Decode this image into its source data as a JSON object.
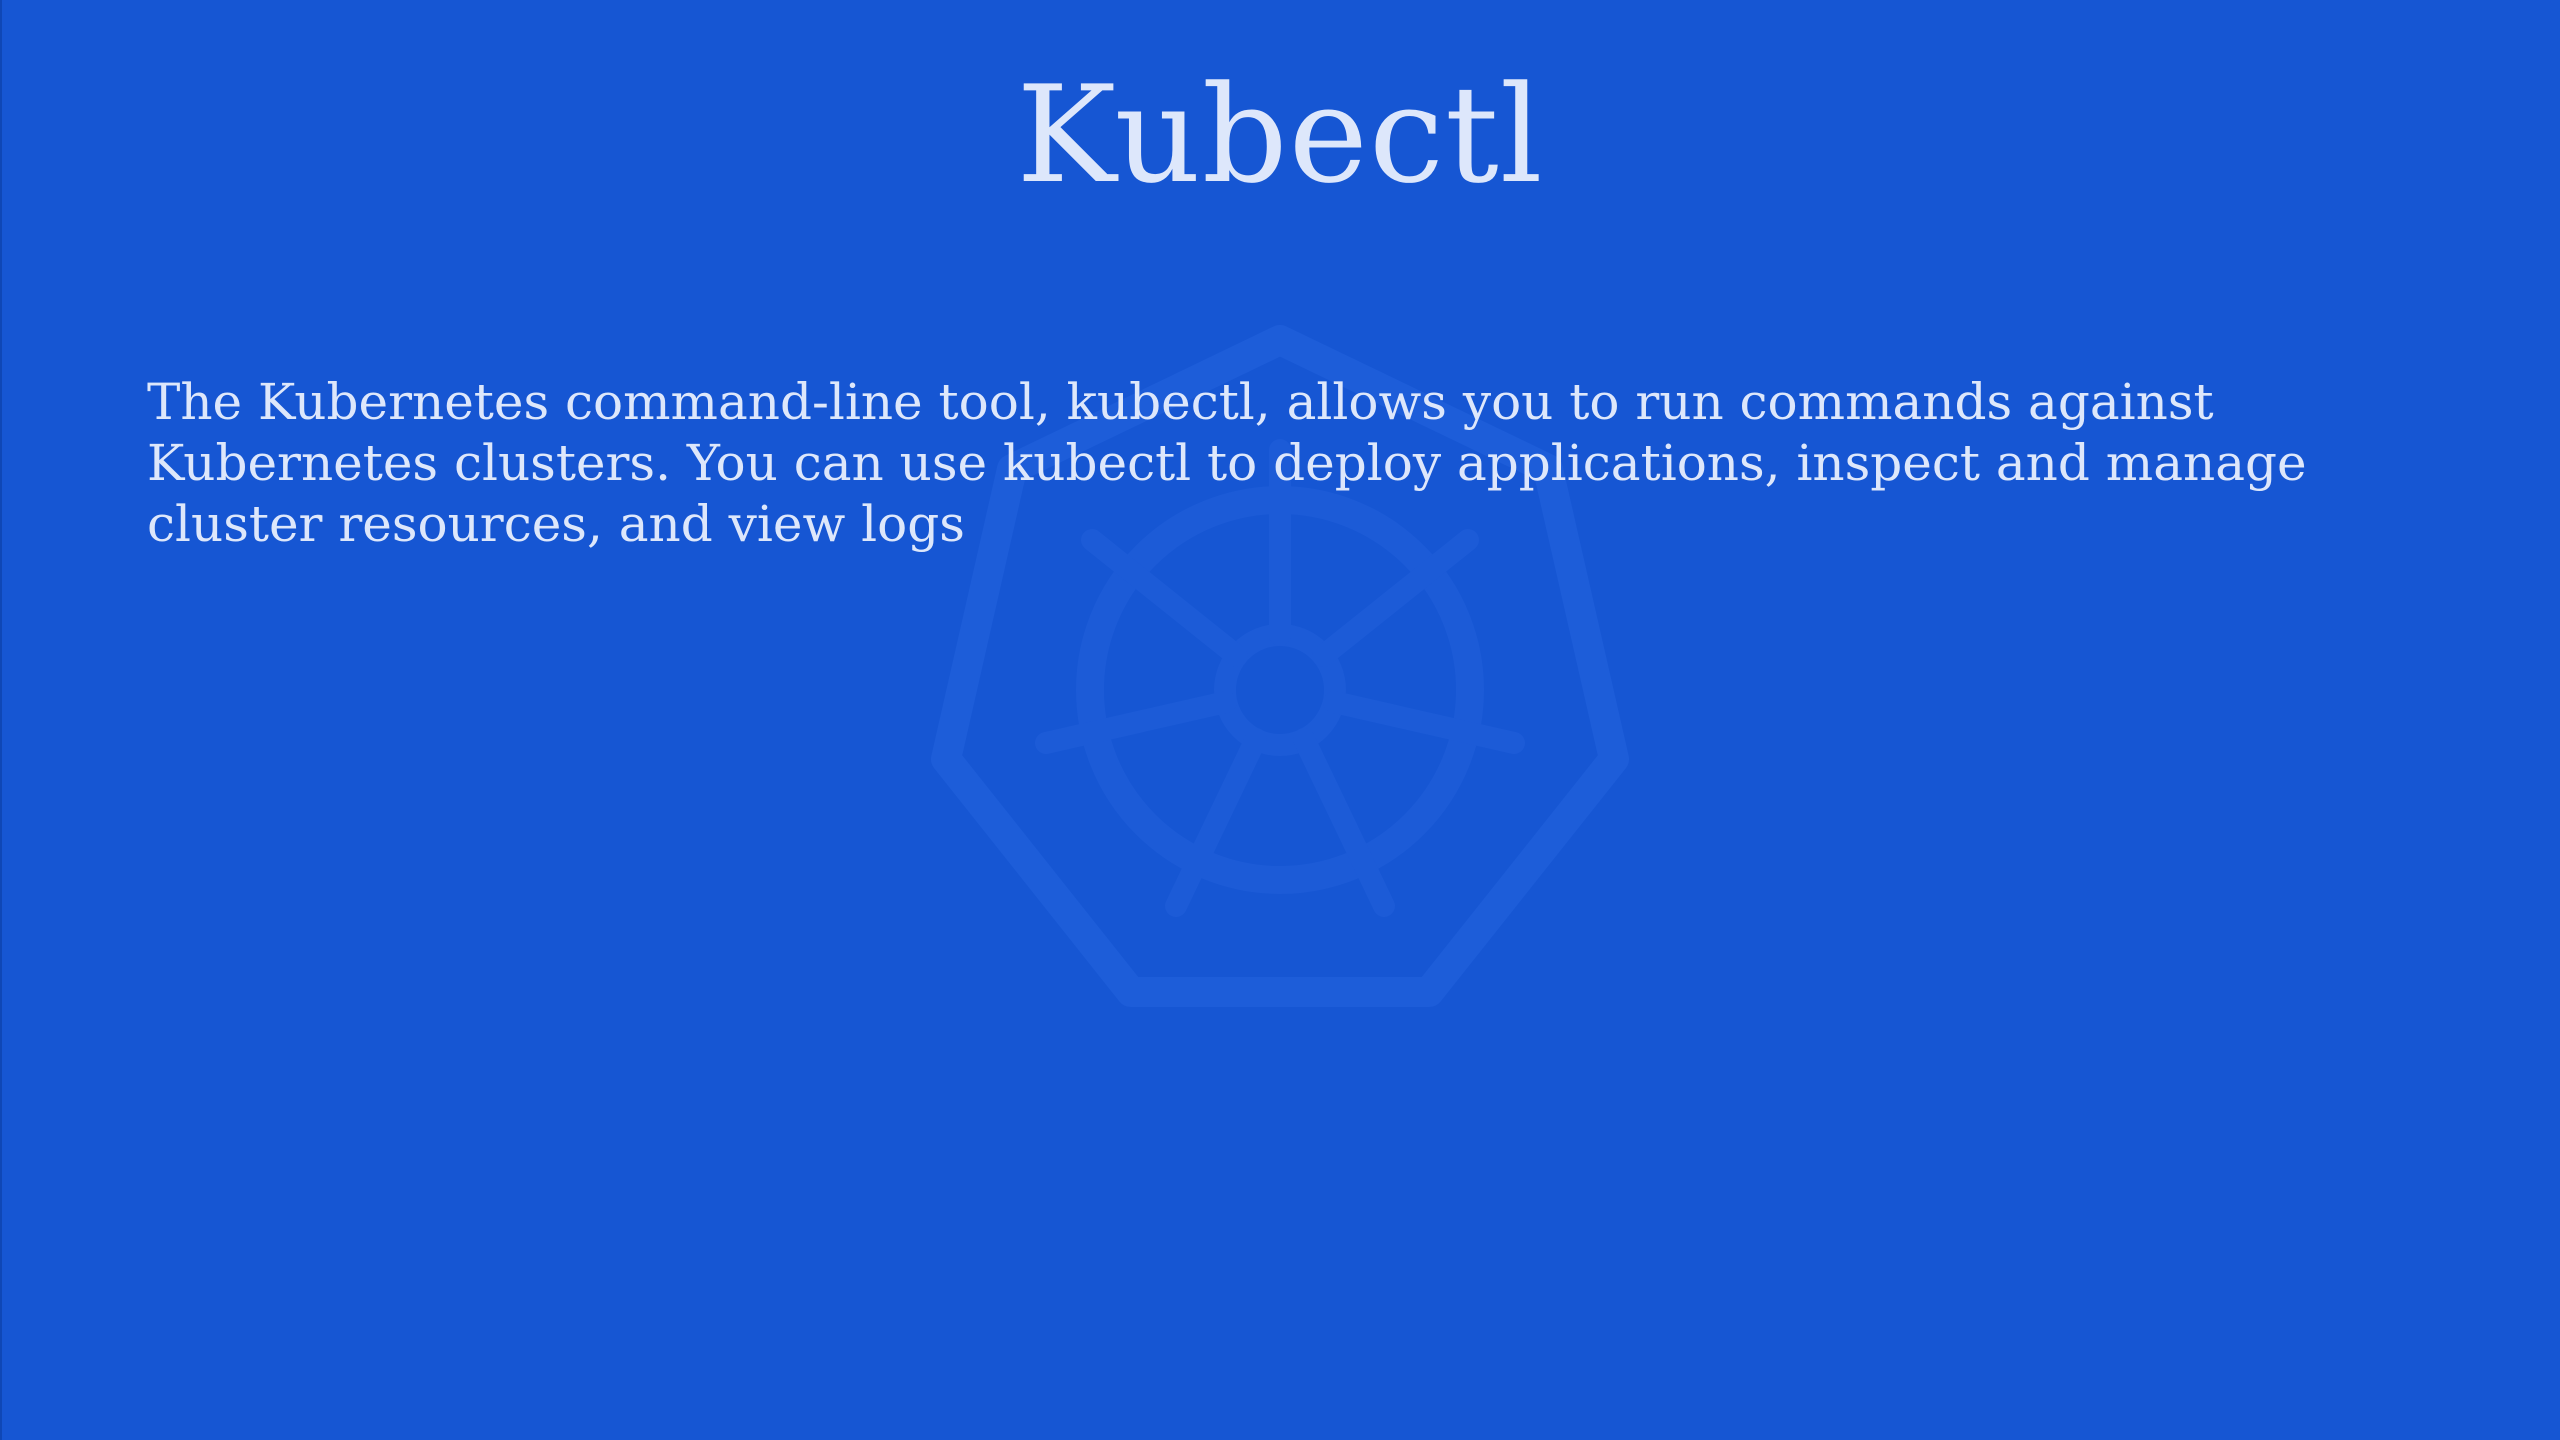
{
  "slide": {
    "title": "Kubectl",
    "body": "The Kubernetes command-line tool, kubectl, allows you to run commands against Kubernetes clusters. You can use kubectl to deploy applications, inspect and manage cluster resources, and view logs"
  },
  "colors": {
    "background": "#1656d3",
    "text": "#dde7fb",
    "watermark": "#1f5fd8"
  },
  "icons": {
    "watermark": "kubernetes-helm-wheel-icon"
  }
}
